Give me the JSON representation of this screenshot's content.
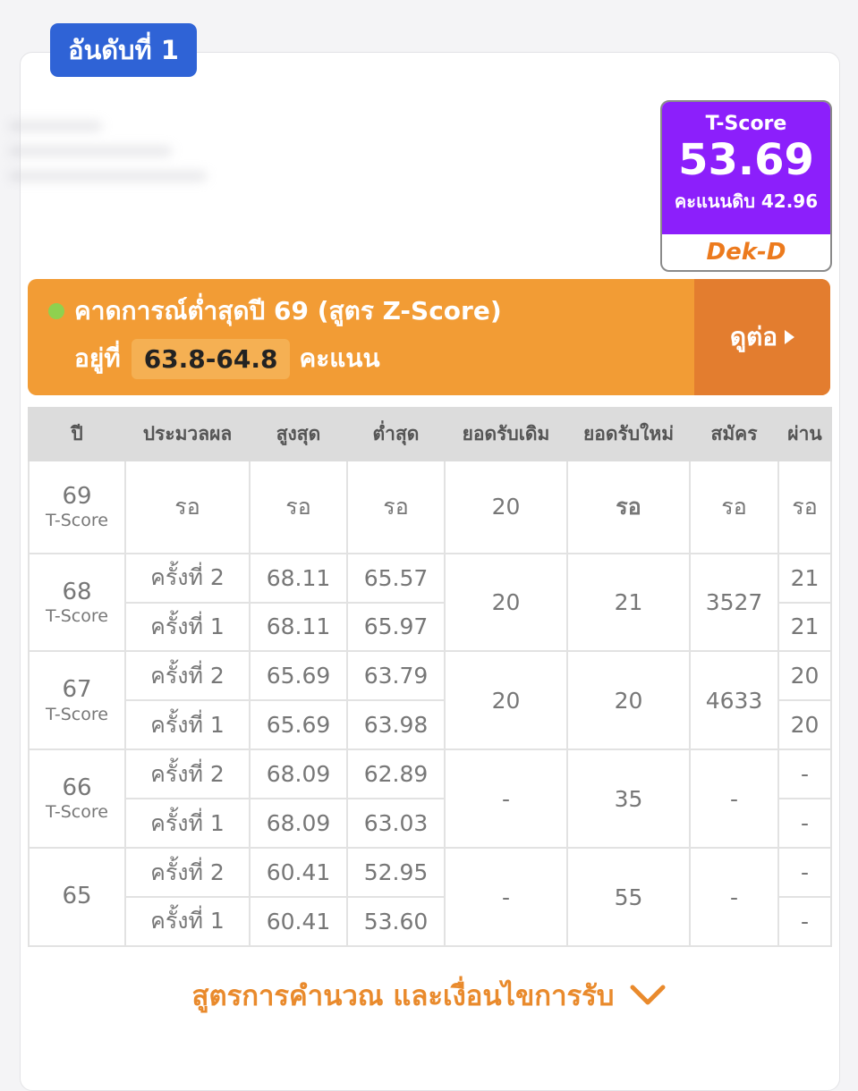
{
  "rank_badge": "อันดับที่ 1",
  "tscore": {
    "label": "T-Score",
    "value": "53.69",
    "raw_label": "คะแนนดิบ 42.96",
    "brand": "Dek-D"
  },
  "forecast": {
    "line1": "คาดการณ์ต่ำสุดปี 69 (สูตร Z-Score)",
    "prefix": "อยู่ที่",
    "range": "63.8-64.8",
    "suffix": "คะแนน",
    "more_label": "ดูต่อ"
  },
  "table": {
    "headers": [
      "ปี",
      "ประมวลผล",
      "สูงสุด",
      "ต่ำสุด",
      "ยอดรับเดิม",
      "ยอดรับใหม่",
      "สมัคร",
      "ผ่าน"
    ],
    "years": [
      {
        "year": "69",
        "unit": "T-Score",
        "rounds": [
          {
            "round": "รอ",
            "max": "รอ",
            "min": "รอ",
            "pass": "รอ"
          }
        ],
        "orig_quota": "20",
        "new_quota": "รอ",
        "applicants": "รอ"
      },
      {
        "year": "68",
        "unit": "T-Score",
        "rounds": [
          {
            "round": "ครั้งที่ 2",
            "max": "68.11",
            "min": "65.57",
            "pass": "21"
          },
          {
            "round": "ครั้งที่ 1",
            "max": "68.11",
            "min": "65.97",
            "pass": "21"
          }
        ],
        "orig_quota": "20",
        "new_quota": "21",
        "applicants": "3527"
      },
      {
        "year": "67",
        "unit": "T-Score",
        "rounds": [
          {
            "round": "ครั้งที่ 2",
            "max": "65.69",
            "min": "63.79",
            "pass": "20"
          },
          {
            "round": "ครั้งที่ 1",
            "max": "65.69",
            "min": "63.98",
            "pass": "20"
          }
        ],
        "orig_quota": "20",
        "new_quota": "20",
        "applicants": "4633"
      },
      {
        "year": "66",
        "unit": "T-Score",
        "rounds": [
          {
            "round": "ครั้งที่ 2",
            "max": "68.09",
            "min": "62.89",
            "pass": "-"
          },
          {
            "round": "ครั้งที่ 1",
            "max": "68.09",
            "min": "63.03",
            "pass": "-"
          }
        ],
        "orig_quota": "-",
        "new_quota": "35",
        "applicants": "-"
      },
      {
        "year": "65",
        "unit": "",
        "rounds": [
          {
            "round": "ครั้งที่ 2",
            "max": "60.41",
            "min": "52.95",
            "pass": "-"
          },
          {
            "round": "ครั้งที่ 1",
            "max": "60.41",
            "min": "53.60",
            "pass": "-"
          }
        ],
        "orig_quota": "-",
        "new_quota": "55",
        "applicants": "-"
      }
    ]
  },
  "footer_link": "สูตรการคำนวณ และเงื่อนไขการรับ",
  "colors": {
    "badge_blue": "#2f63d6",
    "tscore_purple": "#8c1ffb",
    "forecast_orange": "#f29c35",
    "more_orange": "#e37d2f",
    "round_orange": "#ec8a2a",
    "wait_green": "#8fc23f"
  }
}
